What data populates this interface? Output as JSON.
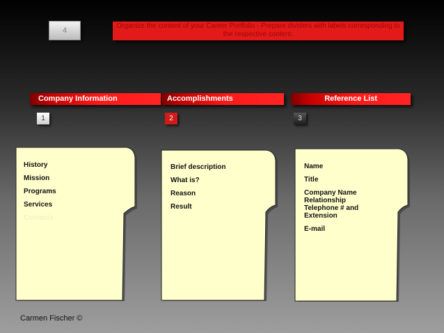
{
  "top_number": "4",
  "banner_text": "Organize the content of your Career Portfolio - Prepare dividers with labels corresponding to the respective content.",
  "columns": [
    {
      "header": "Company Information",
      "number": "1",
      "items": [
        "History",
        "Mission",
        "Programs",
        "Services",
        "Contacts"
      ]
    },
    {
      "header": "Accomplishments",
      "number": "2",
      "items": [
        "Brief description",
        "What is?",
        "Reason",
        "Result"
      ]
    },
    {
      "header": "Reference List",
      "number": "3",
      "items": [
        "Name",
        "Title",
        "Company Name\nRelationship\nTelephone # and Extension",
        "E-mail"
      ]
    }
  ],
  "footer": "Carmen Fischer ©"
}
